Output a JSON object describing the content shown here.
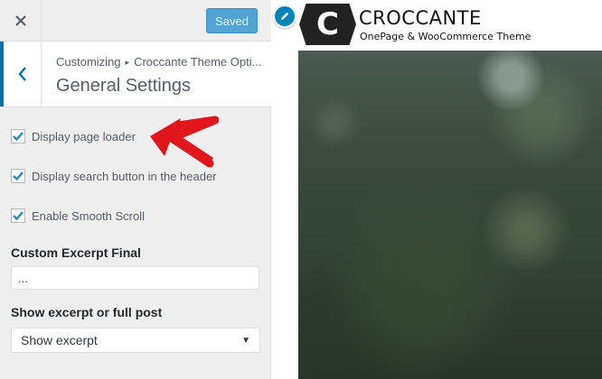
{
  "topbar": {
    "close_icon": "close-icon",
    "save_label": "Saved"
  },
  "section": {
    "back_icon": "chevron-left-icon",
    "breadcrumb_root": "Customizing",
    "breadcrumb_sep": "▸",
    "breadcrumb_parent": "Croccante Theme Opti...",
    "title": "General Settings"
  },
  "options": [
    {
      "label": "Display page loader",
      "checked": true
    },
    {
      "label": "Display search button in the header",
      "checked": true
    },
    {
      "label": "Enable Smooth Scroll",
      "checked": true
    }
  ],
  "excerpt_final": {
    "label": "Custom Excerpt Final",
    "value": "..."
  },
  "excerpt_mode": {
    "label": "Show excerpt or full post",
    "selected": "Show excerpt"
  },
  "preview": {
    "logo_letter": "C",
    "site_title": "CROCCANTE",
    "tagline": "OnePage & WooCommerce Theme"
  },
  "colors": {
    "accent": "#0073aa",
    "save_button": "#53a3d5",
    "checkbox_check": "#1e8cbe",
    "annotation_arrow": "#e2141c"
  }
}
